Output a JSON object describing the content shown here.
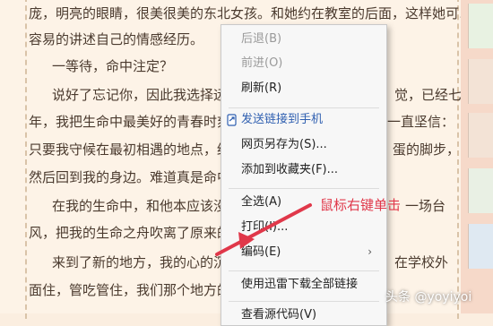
{
  "article": {
    "lines": [
      "庞，明亮的眼睛，很美很美的东北女孩。和她约在教室的后面，这样她可以更",
      "容易的讲述自己的情感经历。",
      "一等待，命中注定？",
      "说好了忘记你，因此我选择远离",
      "觉，已经七",
      "年，我把生命中最美好的青春时刻，",
      "一直坚信：",
      "只要我守候在最初相遇的地点，终究",
      "蛋的脚步，",
      "然后回到我的身边。难道真是命中注",
      "在我的生命中，和他本应该没",
      "一场台",
      "风，把我的生命之舟吹离了原来的航",
      "来到了新的地方，我的心的沉",
      "在学校外",
      "面住，管吃管住，我们那个地方的"
    ]
  },
  "context_menu": {
    "items": [
      {
        "label": "后退(B)",
        "state": "disabled"
      },
      {
        "label": "前进(O)",
        "state": "disabled"
      },
      {
        "label": "刷新(R)",
        "state": "normal"
      },
      {
        "label": "发送链接到手机",
        "state": "link"
      },
      {
        "label": "网页另存为(S)...",
        "state": "normal"
      },
      {
        "label": "添加到收藏夹(F)...",
        "state": "normal"
      },
      {
        "label": "全选(A)",
        "state": "normal"
      },
      {
        "label": "打印(I)...",
        "state": "normal"
      },
      {
        "label": "编码(E)",
        "state": "normal",
        "submenu": "›"
      },
      {
        "label": "使用迅雷下载全部链接",
        "state": "normal"
      },
      {
        "label": "查看源代码(V)",
        "state": "normal"
      }
    ]
  },
  "annotation": {
    "text": "鼠标右键单击",
    "color": "#e0384a"
  },
  "watermark": {
    "text": "头条 @yoyiyoi"
  },
  "colors": {
    "page_bg": "#fdf3e7",
    "text": "#4a3a2e",
    "menu_bg": "#f7f7f7",
    "arrow": "#e0384a"
  }
}
